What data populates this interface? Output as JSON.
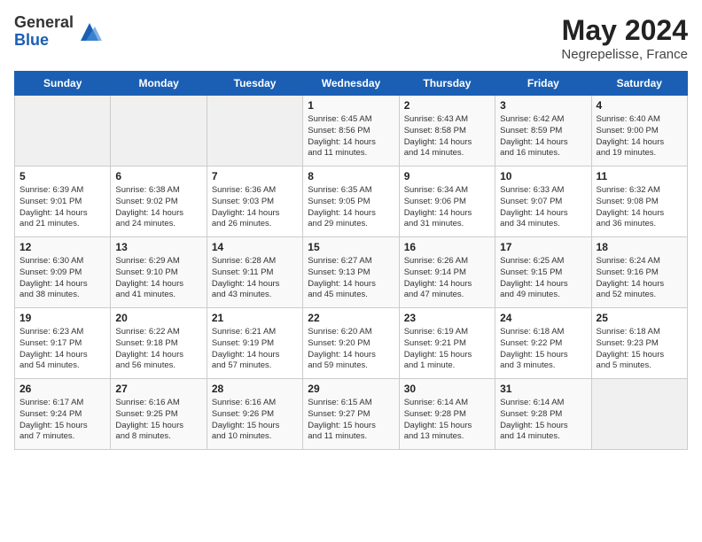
{
  "logo": {
    "general": "General",
    "blue": "Blue"
  },
  "title": "May 2024",
  "location": "Negrepelisse, France",
  "days_header": [
    "Sunday",
    "Monday",
    "Tuesday",
    "Wednesday",
    "Thursday",
    "Friday",
    "Saturday"
  ],
  "weeks": [
    [
      {
        "day": "",
        "info": ""
      },
      {
        "day": "",
        "info": ""
      },
      {
        "day": "",
        "info": ""
      },
      {
        "day": "1",
        "info": "Sunrise: 6:45 AM\nSunset: 8:56 PM\nDaylight: 14 hours\nand 11 minutes."
      },
      {
        "day": "2",
        "info": "Sunrise: 6:43 AM\nSunset: 8:58 PM\nDaylight: 14 hours\nand 14 minutes."
      },
      {
        "day": "3",
        "info": "Sunrise: 6:42 AM\nSunset: 8:59 PM\nDaylight: 14 hours\nand 16 minutes."
      },
      {
        "day": "4",
        "info": "Sunrise: 6:40 AM\nSunset: 9:00 PM\nDaylight: 14 hours\nand 19 minutes."
      }
    ],
    [
      {
        "day": "5",
        "info": "Sunrise: 6:39 AM\nSunset: 9:01 PM\nDaylight: 14 hours\nand 21 minutes."
      },
      {
        "day": "6",
        "info": "Sunrise: 6:38 AM\nSunset: 9:02 PM\nDaylight: 14 hours\nand 24 minutes."
      },
      {
        "day": "7",
        "info": "Sunrise: 6:36 AM\nSunset: 9:03 PM\nDaylight: 14 hours\nand 26 minutes."
      },
      {
        "day": "8",
        "info": "Sunrise: 6:35 AM\nSunset: 9:05 PM\nDaylight: 14 hours\nand 29 minutes."
      },
      {
        "day": "9",
        "info": "Sunrise: 6:34 AM\nSunset: 9:06 PM\nDaylight: 14 hours\nand 31 minutes."
      },
      {
        "day": "10",
        "info": "Sunrise: 6:33 AM\nSunset: 9:07 PM\nDaylight: 14 hours\nand 34 minutes."
      },
      {
        "day": "11",
        "info": "Sunrise: 6:32 AM\nSunset: 9:08 PM\nDaylight: 14 hours\nand 36 minutes."
      }
    ],
    [
      {
        "day": "12",
        "info": "Sunrise: 6:30 AM\nSunset: 9:09 PM\nDaylight: 14 hours\nand 38 minutes."
      },
      {
        "day": "13",
        "info": "Sunrise: 6:29 AM\nSunset: 9:10 PM\nDaylight: 14 hours\nand 41 minutes."
      },
      {
        "day": "14",
        "info": "Sunrise: 6:28 AM\nSunset: 9:11 PM\nDaylight: 14 hours\nand 43 minutes."
      },
      {
        "day": "15",
        "info": "Sunrise: 6:27 AM\nSunset: 9:13 PM\nDaylight: 14 hours\nand 45 minutes."
      },
      {
        "day": "16",
        "info": "Sunrise: 6:26 AM\nSunset: 9:14 PM\nDaylight: 14 hours\nand 47 minutes."
      },
      {
        "day": "17",
        "info": "Sunrise: 6:25 AM\nSunset: 9:15 PM\nDaylight: 14 hours\nand 49 minutes."
      },
      {
        "day": "18",
        "info": "Sunrise: 6:24 AM\nSunset: 9:16 PM\nDaylight: 14 hours\nand 52 minutes."
      }
    ],
    [
      {
        "day": "19",
        "info": "Sunrise: 6:23 AM\nSunset: 9:17 PM\nDaylight: 14 hours\nand 54 minutes."
      },
      {
        "day": "20",
        "info": "Sunrise: 6:22 AM\nSunset: 9:18 PM\nDaylight: 14 hours\nand 56 minutes."
      },
      {
        "day": "21",
        "info": "Sunrise: 6:21 AM\nSunset: 9:19 PM\nDaylight: 14 hours\nand 57 minutes."
      },
      {
        "day": "22",
        "info": "Sunrise: 6:20 AM\nSunset: 9:20 PM\nDaylight: 14 hours\nand 59 minutes."
      },
      {
        "day": "23",
        "info": "Sunrise: 6:19 AM\nSunset: 9:21 PM\nDaylight: 15 hours\nand 1 minute."
      },
      {
        "day": "24",
        "info": "Sunrise: 6:18 AM\nSunset: 9:22 PM\nDaylight: 15 hours\nand 3 minutes."
      },
      {
        "day": "25",
        "info": "Sunrise: 6:18 AM\nSunset: 9:23 PM\nDaylight: 15 hours\nand 5 minutes."
      }
    ],
    [
      {
        "day": "26",
        "info": "Sunrise: 6:17 AM\nSunset: 9:24 PM\nDaylight: 15 hours\nand 7 minutes."
      },
      {
        "day": "27",
        "info": "Sunrise: 6:16 AM\nSunset: 9:25 PM\nDaylight: 15 hours\nand 8 minutes."
      },
      {
        "day": "28",
        "info": "Sunrise: 6:16 AM\nSunset: 9:26 PM\nDaylight: 15 hours\nand 10 minutes."
      },
      {
        "day": "29",
        "info": "Sunrise: 6:15 AM\nSunset: 9:27 PM\nDaylight: 15 hours\nand 11 minutes."
      },
      {
        "day": "30",
        "info": "Sunrise: 6:14 AM\nSunset: 9:28 PM\nDaylight: 15 hours\nand 13 minutes."
      },
      {
        "day": "31",
        "info": "Sunrise: 6:14 AM\nSunset: 9:28 PM\nDaylight: 15 hours\nand 14 minutes."
      },
      {
        "day": "",
        "info": ""
      }
    ]
  ]
}
